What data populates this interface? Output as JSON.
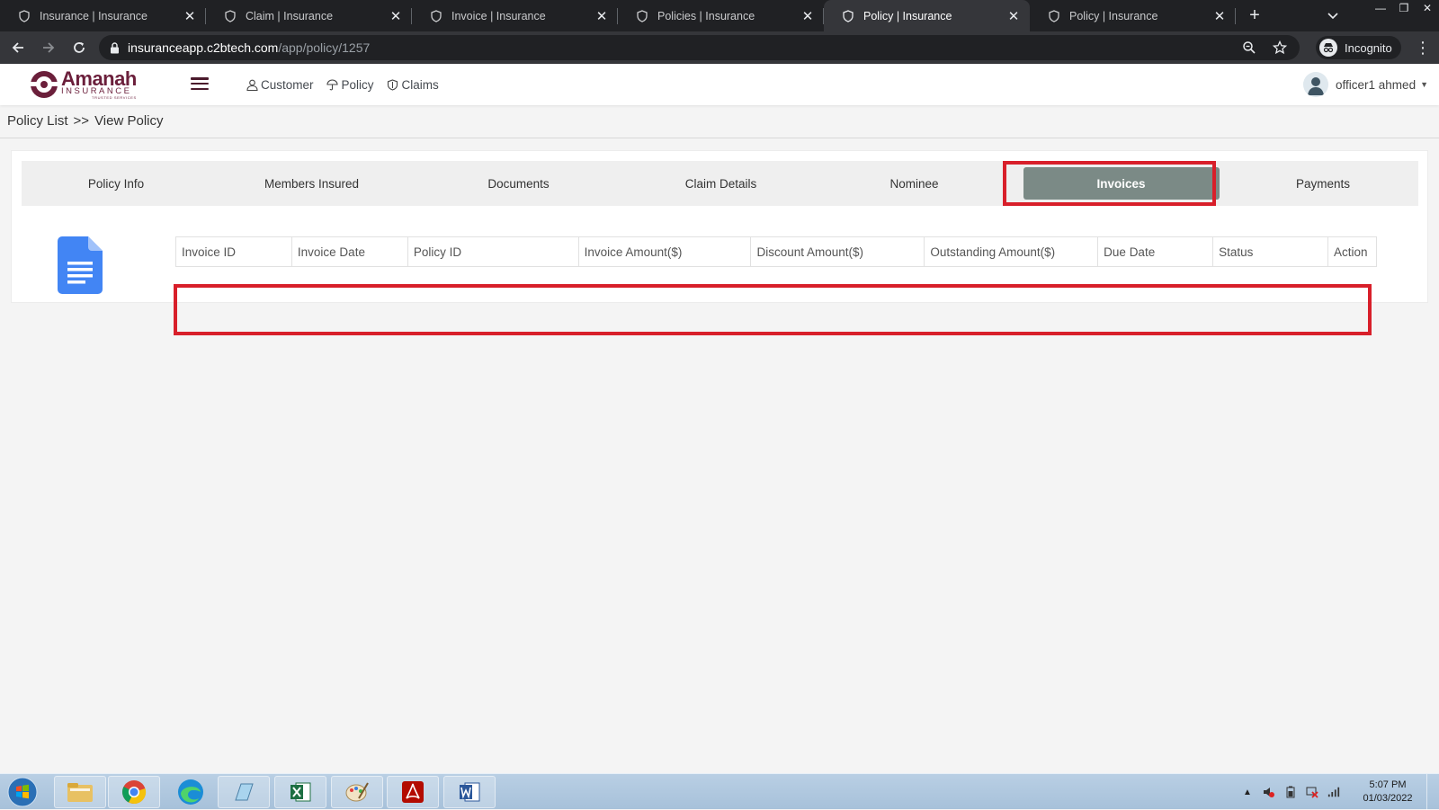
{
  "browser": {
    "tabs": [
      {
        "title": "Insurance | Insurance",
        "active": false
      },
      {
        "title": "Claim | Insurance",
        "active": false
      },
      {
        "title": "Invoice | Insurance",
        "active": false
      },
      {
        "title": "Policies | Insurance",
        "active": false
      },
      {
        "title": "Policy | Insurance",
        "active": true
      },
      {
        "title": "Policy | Insurance",
        "active": false
      }
    ],
    "url_host": "insuranceapp.c2btech.com",
    "url_path": "/app/policy/1257",
    "profile_label": "Incognito"
  },
  "app": {
    "logo_name": "Amanah",
    "logo_sub": "INSURANCE",
    "logo_tagline": "TRUSTED SERVICES",
    "brand_color": "#6b1f3b",
    "nav": [
      {
        "label": "Customer",
        "icon": "user-icon"
      },
      {
        "label": "Policy",
        "icon": "umbrella-icon"
      },
      {
        "label": "Claims",
        "icon": "shield-icon"
      }
    ],
    "user_name": "officer1 ahmed"
  },
  "breadcrumb": {
    "parent": "Policy List",
    "separator": ">>",
    "current": "View Policy"
  },
  "policy_tabs": [
    {
      "label": "Policy Info",
      "active": false
    },
    {
      "label": "Members Insured",
      "active": false
    },
    {
      "label": "Documents",
      "active": false
    },
    {
      "label": "Claim Details",
      "active": false
    },
    {
      "label": "Nominee",
      "active": false
    },
    {
      "label": "Invoices",
      "active": true
    },
    {
      "label": "Payments",
      "active": false
    }
  ],
  "active_tab_color": "#7b8a86",
  "highlight_color": "#d81f2a",
  "invoice_table": {
    "columns": [
      "Invoice ID",
      "Invoice Date",
      "Policy ID",
      "Invoice Amount($)",
      "Discount Amount($)",
      "Outstanding Amount($)",
      "Due Date",
      "Status",
      "Action"
    ],
    "rows": []
  },
  "taskbar": {
    "apps": [
      "file-explorer-icon",
      "chrome-icon",
      "edge-icon",
      "notepad-icon",
      "excel-icon",
      "paint-icon",
      "acrobat-icon",
      "word-icon"
    ],
    "time": "5:07 PM",
    "date": "01/03/2022"
  }
}
